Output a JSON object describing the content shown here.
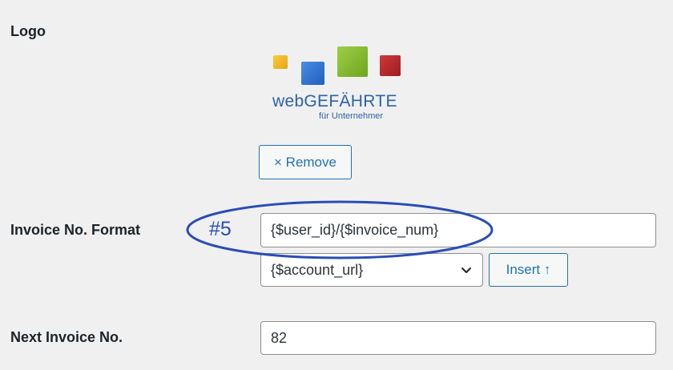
{
  "fields": {
    "logo_label": "Logo",
    "format_label": "Invoice No. Format",
    "next_label": "Next Invoice No."
  },
  "logo": {
    "wordmark": "webGEFÄHRTE",
    "tagline": "für Unternehmer"
  },
  "remove_button": {
    "label": "× Remove"
  },
  "format_input": {
    "value": "{$user_id}/{$invoice_num}"
  },
  "placeholder_select": {
    "selected": "{$account_url}",
    "icon": "chevron-down-icon"
  },
  "insert_button": {
    "label": "Insert ↑"
  },
  "next_input": {
    "value": "82"
  },
  "annotation": {
    "label": "#5",
    "color": "#2a4db5"
  },
  "colors": {
    "background": "#f0f0f1",
    "accent": "#2271b1",
    "input_border": "#8c8f94"
  }
}
